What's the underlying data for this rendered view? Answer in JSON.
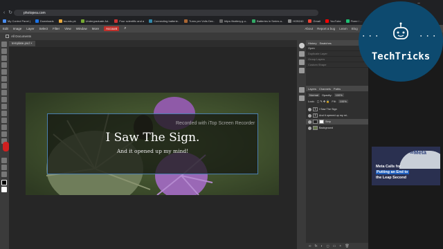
{
  "browser": {
    "url": "photopea.com",
    "bookmarks": [
      "My Control Panel |",
      "Downloads",
      "iss.edu.pk",
      "Undergraduate Ad..",
      "Four scientific and a",
      "Connecting batterie..",
      "Turns per Volts Dev..",
      "https://battery.g-u..",
      "Batteries in Series a..",
      "HOB240",
      "Gmail",
      "YouTube",
      "Fiverr / ..."
    ]
  },
  "menu": {
    "items": [
      "Edit",
      "Image",
      "Layer",
      "Select",
      "Filter",
      "View",
      "Window",
      "More"
    ],
    "account": "Account",
    "right_items": [
      "About",
      "Report a bug",
      "Learn",
      "Blog",
      "API"
    ]
  },
  "options": {
    "label": "All Documents"
  },
  "document": {
    "tab_name": "template.psd"
  },
  "artwork": {
    "title": "I Saw The Sign.",
    "subtitle": "And it opened up my mind!",
    "watermark": "Recorded with iTop Screen Recorder"
  },
  "history": {
    "tabs": [
      "History",
      "Swatches"
    ],
    "entries": [
      "Open",
      "Duplicate Layer",
      "Group Layers",
      "Custom Shape"
    ]
  },
  "layers": {
    "tabs": [
      "Layers",
      "Channels",
      "Paths"
    ],
    "blend_mode": "Normal",
    "opacity_label": "Opacity:",
    "opacity": "100%",
    "lock_label": "Lock:",
    "fill_label": "Fill:",
    "fill": "100%",
    "items": [
      "I Saw The Sign",
      "And it opened up my mi..",
      "Strip",
      "Background"
    ]
  },
  "brand": {
    "name": "TechTricks"
  },
  "video": {
    "logo": "Meta",
    "headline1": "Meta Calls for",
    "headline2": "Putting an End to",
    "headline3": "the Leap Second"
  },
  "colors": {
    "accent": "#c0302b",
    "badge": "#0d4a6f"
  }
}
